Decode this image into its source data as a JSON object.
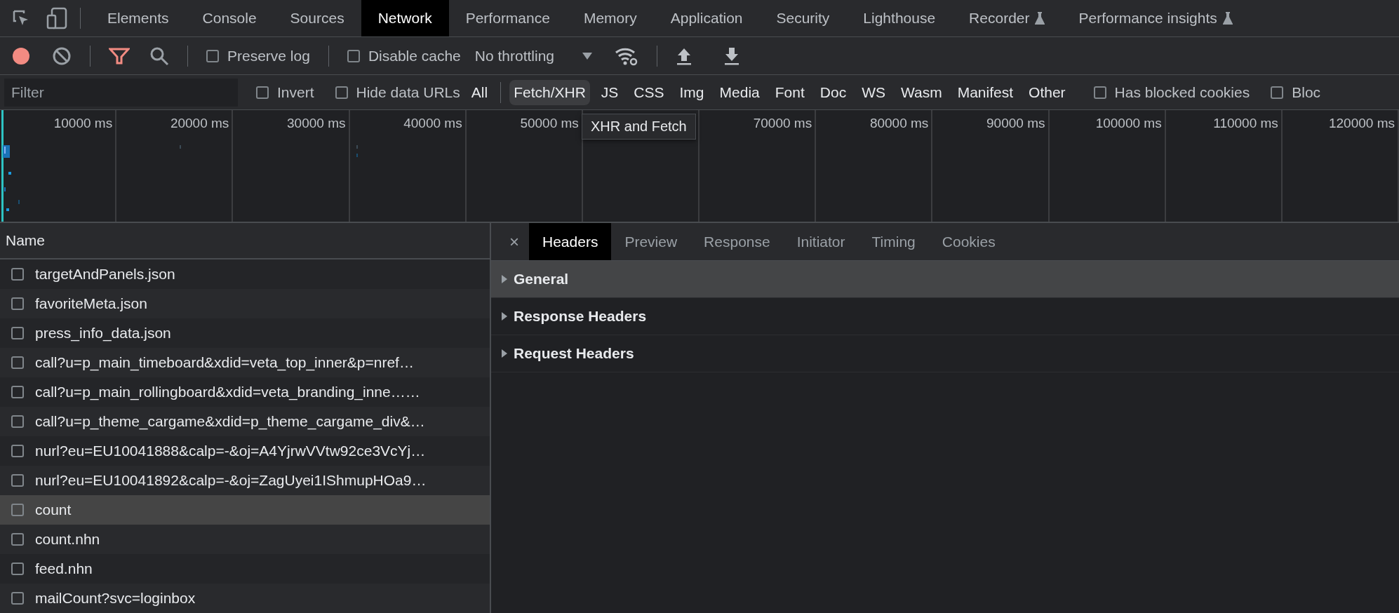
{
  "panel_tabs": [
    {
      "label": "Elements",
      "selected": false,
      "experimental": false
    },
    {
      "label": "Console",
      "selected": false,
      "experimental": false
    },
    {
      "label": "Sources",
      "selected": false,
      "experimental": false
    },
    {
      "label": "Network",
      "selected": true,
      "experimental": false
    },
    {
      "label": "Performance",
      "selected": false,
      "experimental": false
    },
    {
      "label": "Memory",
      "selected": false,
      "experimental": false
    },
    {
      "label": "Application",
      "selected": false,
      "experimental": false
    },
    {
      "label": "Security",
      "selected": false,
      "experimental": false
    },
    {
      "label": "Lighthouse",
      "selected": false,
      "experimental": false
    },
    {
      "label": "Recorder",
      "selected": false,
      "experimental": true
    },
    {
      "label": "Performance insights",
      "selected": false,
      "experimental": true
    }
  ],
  "toolbar": {
    "recording": true,
    "preserve_log": {
      "label": "Preserve log",
      "checked": false
    },
    "disable_cache": {
      "label": "Disable cache",
      "checked": false
    },
    "throttling": "No throttling"
  },
  "filter_bar": {
    "placeholder": "Filter",
    "invert": {
      "label": "Invert",
      "checked": false
    },
    "hide_data_urls": {
      "label": "Hide data URLs",
      "checked": false
    },
    "types": [
      {
        "label": "All",
        "selected": false
      },
      {
        "label": "Fetch/XHR",
        "selected": true
      },
      {
        "label": "JS",
        "selected": false
      },
      {
        "label": "CSS",
        "selected": false
      },
      {
        "label": "Img",
        "selected": false
      },
      {
        "label": "Media",
        "selected": false
      },
      {
        "label": "Font",
        "selected": false
      },
      {
        "label": "Doc",
        "selected": false
      },
      {
        "label": "WS",
        "selected": false
      },
      {
        "label": "Wasm",
        "selected": false
      },
      {
        "label": "Manifest",
        "selected": false
      },
      {
        "label": "Other",
        "selected": false
      }
    ],
    "has_blocked_cookies": {
      "label": "Has blocked cookies",
      "checked": false
    },
    "blocked_requests": {
      "label": "Bloc",
      "checked": false
    }
  },
  "tooltip": "XHR and Fetch",
  "timeline": {
    "ticks": [
      "10000 ms",
      "20000 ms",
      "30000 ms",
      "40000 ms",
      "50000 ms"
    ],
    "ticks_after_tooltip": [
      "70000 ms",
      "80000 ms",
      "90000 ms",
      "100000 ms",
      "110000 ms",
      "120000 ms"
    ]
  },
  "requests": {
    "column": "Name",
    "rows": [
      {
        "name": "targetAndPanels.json",
        "selected": false
      },
      {
        "name": "favoriteMeta.json",
        "selected": false
      },
      {
        "name": "press_info_data.json",
        "selected": false
      },
      {
        "name": "call?u=p_main_timeboard&xdid=veta_top_inner&p=nref…",
        "selected": false
      },
      {
        "name": "call?u=p_main_rollingboard&xdid=veta_branding_inne……",
        "selected": false
      },
      {
        "name": "call?u=p_theme_cargame&xdid=p_theme_cargame_div&…",
        "selected": false
      },
      {
        "name": "nurl?eu=EU10041888&calp=-&oj=A4YjrwVVtw92ce3VcYj…",
        "selected": false
      },
      {
        "name": "nurl?eu=EU10041892&calp=-&oj=ZagUyei1IShmupHOa9…",
        "selected": false
      },
      {
        "name": "count",
        "selected": true
      },
      {
        "name": "count.nhn",
        "selected": false
      },
      {
        "name": "feed.nhn",
        "selected": false
      },
      {
        "name": "mailCount?svc=loginbox",
        "selected": false
      }
    ]
  },
  "details": {
    "close": "×",
    "tabs": [
      {
        "label": "Headers",
        "selected": true
      },
      {
        "label": "Preview",
        "selected": false
      },
      {
        "label": "Response",
        "selected": false
      },
      {
        "label": "Initiator",
        "selected": false
      },
      {
        "label": "Timing",
        "selected": false
      },
      {
        "label": "Cookies",
        "selected": false
      }
    ],
    "sections": [
      {
        "title": "General",
        "expanded": false,
        "selected": true
      },
      {
        "title": "Response Headers",
        "expanded": false,
        "selected": false
      },
      {
        "title": "Request Headers",
        "expanded": false,
        "selected": false
      }
    ]
  }
}
